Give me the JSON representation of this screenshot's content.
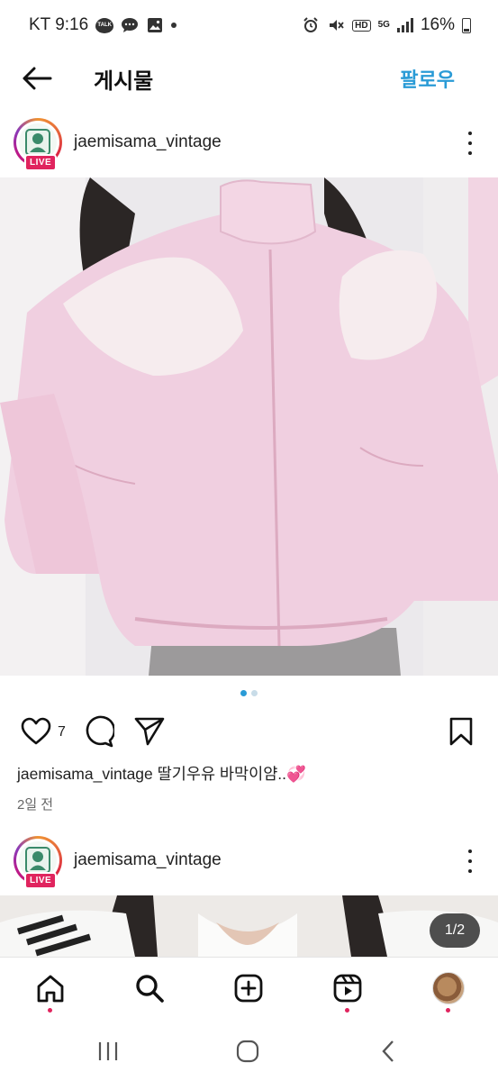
{
  "status_bar": {
    "carrier_time": "KT 9:16",
    "talk_label": "TALK",
    "network": "5G",
    "hd": "HD",
    "battery": "16%"
  },
  "header": {
    "title": "게시물",
    "follow_label": "팔로우"
  },
  "posts": [
    {
      "username": "jaemisama_vintage",
      "live_label": "LIVE",
      "like_count": "7",
      "caption_user": "jaemisama_vintage",
      "caption_text": " 딸기우유 바막이얌..💞",
      "time": "2일 전",
      "carousel_total": 2,
      "carousel_active": 1
    },
    {
      "username": "jaemisama_vintage",
      "live_label": "LIVE",
      "counter": "1/2"
    }
  ],
  "colors": {
    "accent": "#2a9bd6",
    "live": "#e0245e",
    "jacket": "#f0cfe0"
  },
  "icons": {
    "back": "arrow-left-icon",
    "more": "more-vertical-icon",
    "like": "heart-icon",
    "comment": "comment-icon",
    "share": "send-icon",
    "save": "bookmark-icon",
    "home": "home-icon",
    "search": "search-icon",
    "create": "plus-square-icon",
    "reels": "reels-icon",
    "recents": "recents-icon",
    "home_sys": "home-circle-icon",
    "back_sys": "chevron-left-icon"
  }
}
